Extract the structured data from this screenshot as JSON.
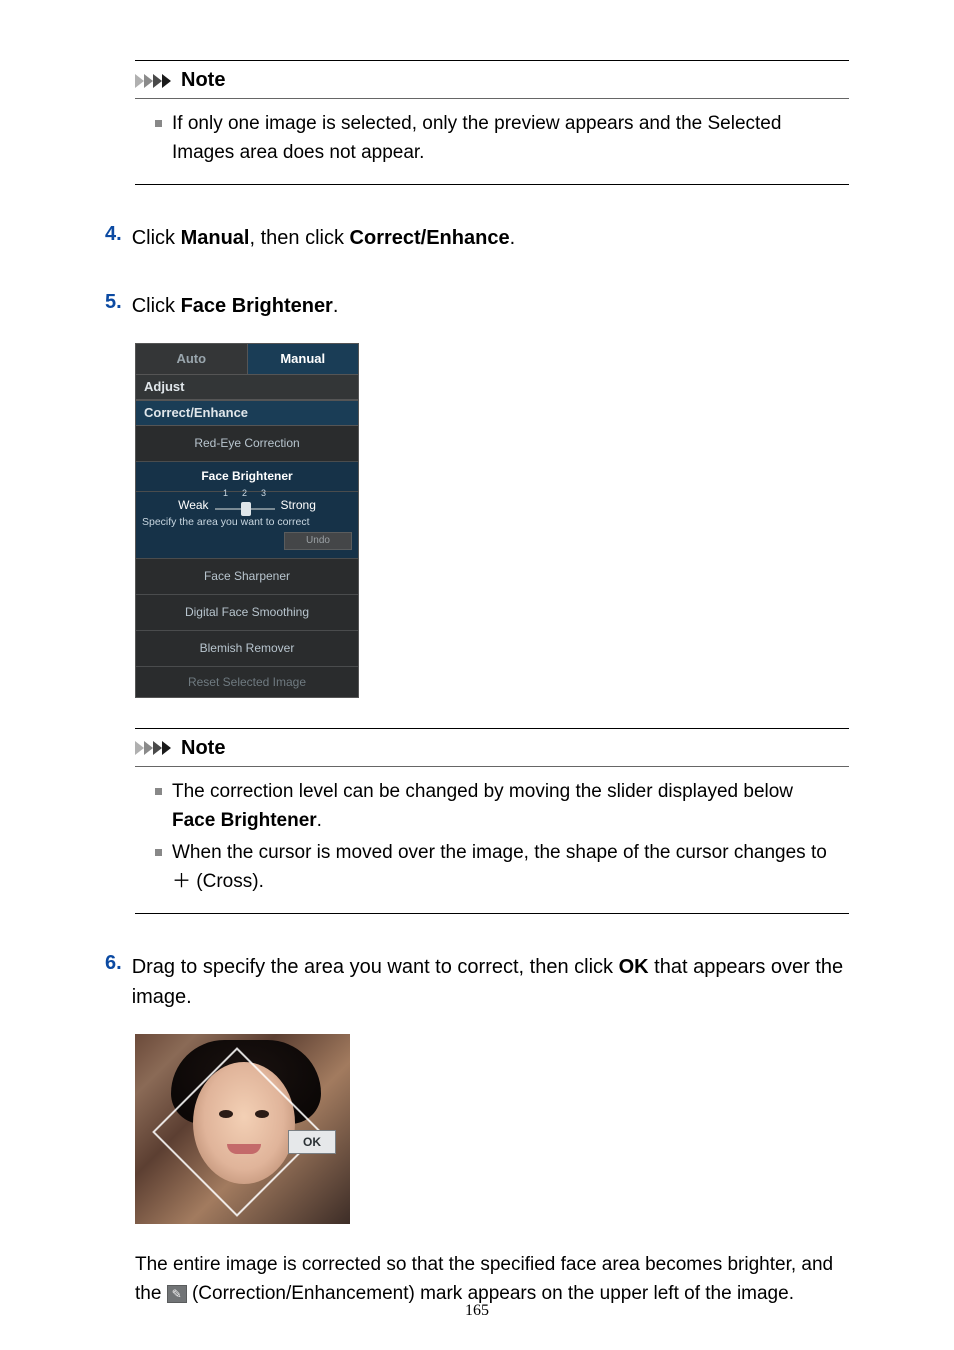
{
  "note1": {
    "title": "Note",
    "items": [
      "If only one image is selected, only the preview appears and the Selected Images area does not appear."
    ]
  },
  "step4": {
    "num": "4.",
    "pre": "Click ",
    "b1": "Manual",
    "mid": ", then click ",
    "b2": "Correct/Enhance",
    "post": "."
  },
  "step5": {
    "num": "5.",
    "pre": "Click ",
    "b1": "Face Brightener",
    "post": "."
  },
  "panel": {
    "tabAuto": "Auto",
    "tabManual": "Manual",
    "adjust": "Adjust",
    "correctEnhance": "Correct/Enhance",
    "redEye": "Red-Eye Correction",
    "faceBrightener": "Face Brightener",
    "weak": "Weak",
    "strong": "Strong",
    "t1": "1",
    "t2": "2",
    "t3": "3",
    "specify": "Specify the area you want to correct",
    "undo": "Undo",
    "faceSharpener": "Face Sharpener",
    "digitalFace": "Digital Face Smoothing",
    "blemish": "Blemish Remover",
    "reset": "Reset Selected Image"
  },
  "note2": {
    "title": "Note",
    "items": [
      {
        "pre": "The correction level can be changed by moving the slider displayed below ",
        "b1": "Face Brightener",
        "post": "."
      },
      {
        "pre": "When the cursor is moved over the image, the shape of the cursor changes to ",
        "sym": "＋",
        "post": " (Cross)."
      }
    ]
  },
  "step6": {
    "num": "6.",
    "pre": "Drag to specify the area you want to correct, then click ",
    "b1": "OK",
    "post": " that appears over the image."
  },
  "ok": "OK",
  "para": {
    "pre": "The entire image is corrected so that the specified face area becomes brighter, and the ",
    "post": " (Correction/Enhancement) mark appears on the upper left of the image."
  },
  "pageNum": "165"
}
